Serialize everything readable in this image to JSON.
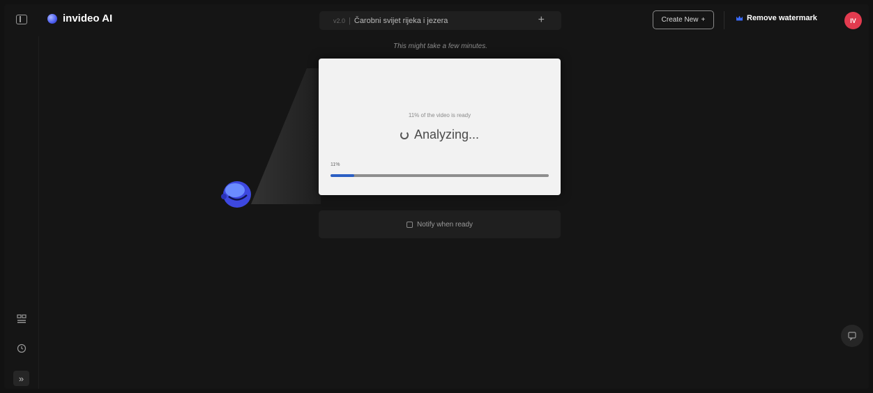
{
  "app": {
    "brand": "invideo AI"
  },
  "header": {
    "version": "v2.0",
    "project_title": "Čarobni svijet rijeka i jezera",
    "add_label": "+",
    "create_new_label": "Create New",
    "create_new_icon": "+",
    "remove_watermark_label": "Remove watermark",
    "avatar_initials": "IV"
  },
  "main": {
    "hint": "This might take a few minutes.",
    "progress_text": "11% of the video is ready",
    "status": "Analyzing...",
    "percent_label": "11%",
    "progress_fraction": 0.11,
    "notify_label": "Notify when ready"
  },
  "sidebar": {
    "expand_icon": "»"
  },
  "colors": {
    "background": "#151515",
    "card": "#f2f2f2",
    "accent": "#2b5fc4",
    "avatar": "#e23b4f"
  },
  "icons": [
    "panel-toggle-icon",
    "brand-logo-icon",
    "crown-icon",
    "templates-icon",
    "history-icon",
    "expand-icon",
    "chat-icon",
    "spinner-icon",
    "checkbox-icon"
  ]
}
